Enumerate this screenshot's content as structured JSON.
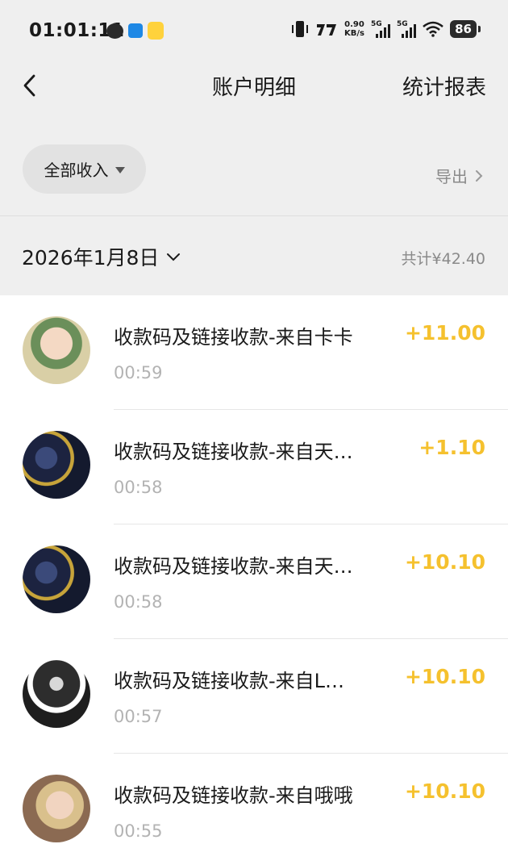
{
  "status_bar": {
    "time": "01:01:11",
    "net_speed_value": "0.90",
    "net_speed_unit": "KB/s",
    "signal1_label": "5G",
    "signal2_label": "5G",
    "battery": "86",
    "app_icons": [
      "wechat-icon",
      "blue-app-icon",
      "yellow-app-icon"
    ]
  },
  "nav": {
    "title": "账户明细",
    "report_link": "统计报表"
  },
  "filter": {
    "label": "全部收入",
    "export_label": "导出"
  },
  "summary": {
    "date": "2026年1月8日",
    "total": "共计¥42.40"
  },
  "colors": {
    "amount": "#f5c12e",
    "header_bg": "#efefef"
  },
  "transactions": [
    {
      "title": "收款码及链接收款-来自卡卡",
      "amount": "+11.00",
      "time": "00:59"
    },
    {
      "title": "收款码及链接收款-来自天…",
      "amount": "+1.10",
      "time": "00:58"
    },
    {
      "title": "收款码及链接收款-来自天…",
      "amount": "+10.10",
      "time": "00:58"
    },
    {
      "title": "收款码及链接收款-来自L…",
      "amount": "+10.10",
      "time": "00:57"
    },
    {
      "title": "收款码及链接收款-来自哦哦",
      "amount": "+10.10",
      "time": "00:55"
    }
  ]
}
